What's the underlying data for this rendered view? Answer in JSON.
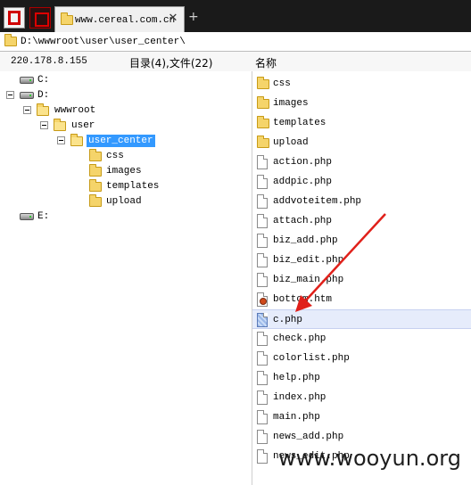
{
  "tab": {
    "label": "www.cereal.com.cn",
    "close_glyph": "✕",
    "new_tab_glyph": "+"
  },
  "address": {
    "path": "D:\\wwwroot\\user\\user_center\\"
  },
  "status": {
    "host": "220.178.8.155",
    "summary": "目录(4),文件(22)",
    "column_name": "名称"
  },
  "tree": {
    "drive_c": "C:",
    "drive_d": "D:",
    "wwwroot": "wwwroot",
    "user": "user",
    "user_center": "user_center",
    "css": "css",
    "images": "images",
    "templates": "templates",
    "upload": "upload",
    "drive_e": "E:"
  },
  "files": [
    {
      "name": "css",
      "type": "folder"
    },
    {
      "name": "images",
      "type": "folder"
    },
    {
      "name": "templates",
      "type": "folder"
    },
    {
      "name": "upload",
      "type": "folder"
    },
    {
      "name": "action.php",
      "type": "php"
    },
    {
      "name": "addpic.php",
      "type": "php"
    },
    {
      "name": "addvoteitem.php",
      "type": "php"
    },
    {
      "name": "attach.php",
      "type": "php"
    },
    {
      "name": "biz_add.php",
      "type": "php"
    },
    {
      "name": "biz_edit.php",
      "type": "php"
    },
    {
      "name": "biz_main.php",
      "type": "php"
    },
    {
      "name": "bottom.htm",
      "type": "htm"
    },
    {
      "name": "c.php",
      "type": "php",
      "selected": true
    },
    {
      "name": "check.php",
      "type": "php"
    },
    {
      "name": "colorlist.php",
      "type": "php"
    },
    {
      "name": "help.php",
      "type": "php"
    },
    {
      "name": "index.php",
      "type": "php"
    },
    {
      "name": "main.php",
      "type": "php"
    },
    {
      "name": "news_add.php",
      "type": "php"
    },
    {
      "name": "news_edit.php",
      "type": "php"
    }
  ],
  "watermark": "www.wooyun.org",
  "colors": {
    "selection": "#3399ff",
    "arrow": "#e0201a",
    "tabbar": "#1a1a1a"
  }
}
